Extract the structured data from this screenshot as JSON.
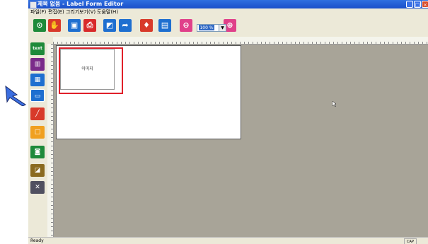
{
  "window": {
    "title": "제목 없음 - Label Form Editor",
    "controls": {
      "minimize": "_",
      "maximize": "□",
      "close": "×"
    }
  },
  "menubar": {
    "items": [
      "파일(F)",
      "편집(E)",
      "그리기",
      "보기(V)",
      "도움말(H)"
    ]
  },
  "toolbar": {
    "zoom_value": "100 %",
    "buttons": [
      {
        "icon": "new-icon",
        "color": "#1e8a3a"
      },
      {
        "icon": "open-hand-icon",
        "color": "#d83a2a"
      },
      {
        "icon": "save-disk-icon",
        "color": "#1e6fd0"
      },
      {
        "icon": "print-icon",
        "color": "#d82a2a"
      },
      {
        "icon": "export-icon",
        "color": "#1e6fd0"
      },
      {
        "icon": "send-icon",
        "color": "#1e6fd0"
      },
      {
        "icon": "pin-icon",
        "color": "#d83a2a"
      },
      {
        "icon": "printer-setup-icon",
        "color": "#1e6fd0"
      },
      {
        "icon": "zoom-out-icon",
        "color": "#e0408a"
      },
      {
        "icon": "zoom-in-icon",
        "color": "#e0408a"
      }
    ]
  },
  "left_tools": [
    {
      "label": "text",
      "icon": "text-tool-icon",
      "color": "#1e8a3a"
    },
    {
      "label": "",
      "icon": "barcode-tool-icon",
      "color": "#7a2a8a"
    },
    {
      "label": "",
      "icon": "qrcode-tool-icon",
      "color": "#1e6fd0"
    },
    {
      "label": "",
      "icon": "image-tool-icon",
      "color": "#1e6fd0"
    },
    {
      "label": "",
      "icon": "line-tool-icon",
      "color": "#d83a2a"
    },
    {
      "label": "",
      "icon": "rectangle-tool-icon",
      "color": "#f0a020"
    },
    {
      "label": "",
      "icon": "picture-frame-tool-icon",
      "color": "#1e8a3a"
    },
    {
      "label": "",
      "icon": "document-tool-icon",
      "color": "#8a6a20"
    },
    {
      "label": "",
      "icon": "settings-tool-icon",
      "color": "#505060"
    }
  ],
  "label_canvas": {
    "image_object_text": "이미지"
  },
  "status": {
    "text": "Ready",
    "cap": "CAP"
  }
}
